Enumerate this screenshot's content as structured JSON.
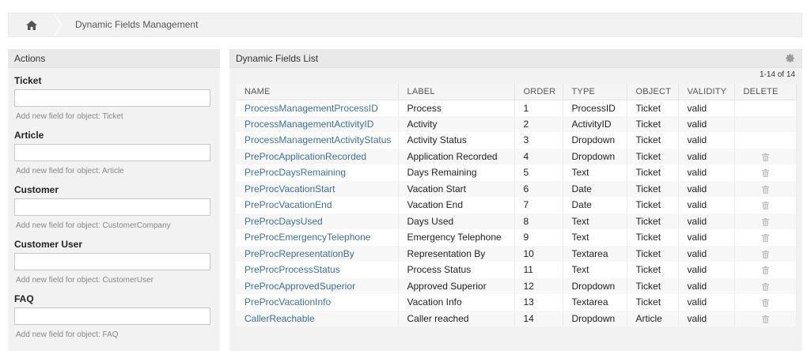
{
  "breadcrumb": {
    "home_icon": "home-icon",
    "title": "Dynamic Fields Management"
  },
  "sidebar": {
    "header": "Actions",
    "objects": [
      {
        "title": "Ticket",
        "hint": "Add new field for object: Ticket"
      },
      {
        "title": "Article",
        "hint": "Add new field for object: Article"
      },
      {
        "title": "Customer",
        "hint": "Add new field for object: CustomerCompany"
      },
      {
        "title": "Customer User",
        "hint": "Add new field for object: CustomerUser"
      },
      {
        "title": "FAQ",
        "hint": "Add new field for object: FAQ"
      }
    ]
  },
  "main": {
    "header": "Dynamic Fields List",
    "settings_icon": "gear-icon",
    "pager": "1-14 of 14",
    "columns": [
      "NAME",
      "LABEL",
      "ORDER",
      "TYPE",
      "OBJECT",
      "VALIDITY",
      "DELETE"
    ],
    "rows": [
      {
        "name": "ProcessManagementProcessID",
        "label": "Process",
        "order": "1",
        "type": "ProcessID",
        "object": "Ticket",
        "validity": "valid",
        "deletable": false
      },
      {
        "name": "ProcessManagementActivityID",
        "label": "Activity",
        "order": "2",
        "type": "ActivityID",
        "object": "Ticket",
        "validity": "valid",
        "deletable": false
      },
      {
        "name": "ProcessManagementActivityStatus",
        "label": "Activity Status",
        "order": "3",
        "type": "Dropdown",
        "object": "Ticket",
        "validity": "valid",
        "deletable": false
      },
      {
        "name": "PreProcApplicationRecorded",
        "label": "Application Recorded",
        "order": "4",
        "type": "Dropdown",
        "object": "Ticket",
        "validity": "valid",
        "deletable": true
      },
      {
        "name": "PreProcDaysRemaining",
        "label": "Days Remaining",
        "order": "5",
        "type": "Text",
        "object": "Ticket",
        "validity": "valid",
        "deletable": true
      },
      {
        "name": "PreProcVacationStart",
        "label": "Vacation Start",
        "order": "6",
        "type": "Date",
        "object": "Ticket",
        "validity": "valid",
        "deletable": true
      },
      {
        "name": "PreProcVacationEnd",
        "label": "Vacation End",
        "order": "7",
        "type": "Date",
        "object": "Ticket",
        "validity": "valid",
        "deletable": true
      },
      {
        "name": "PreProcDaysUsed",
        "label": "Days Used",
        "order": "8",
        "type": "Text",
        "object": "Ticket",
        "validity": "valid",
        "deletable": true
      },
      {
        "name": "PreProcEmergencyTelephone",
        "label": "Emergency Telephone",
        "order": "9",
        "type": "Text",
        "object": "Ticket",
        "validity": "valid",
        "deletable": true
      },
      {
        "name": "PreProcRepresentationBy",
        "label": "Representation By",
        "order": "10",
        "type": "Textarea",
        "object": "Ticket",
        "validity": "valid",
        "deletable": true
      },
      {
        "name": "PreProcProcessStatus",
        "label": "Process Status",
        "order": "11",
        "type": "Text",
        "object": "Ticket",
        "validity": "valid",
        "deletable": true
      },
      {
        "name": "PreProcApprovedSuperior",
        "label": "Approved Superior",
        "order": "12",
        "type": "Dropdown",
        "object": "Ticket",
        "validity": "valid",
        "deletable": true
      },
      {
        "name": "PreProcVacationInfo",
        "label": "Vacation Info",
        "order": "13",
        "type": "Textarea",
        "object": "Ticket",
        "validity": "valid",
        "deletable": true
      },
      {
        "name": "CallerReachable",
        "label": "Caller reached",
        "order": "14",
        "type": "Dropdown",
        "object": "Article",
        "validity": "valid",
        "deletable": true
      }
    ]
  },
  "colors": {
    "link": "#3f6f9a",
    "panel_bg": "#f2f2f2"
  }
}
